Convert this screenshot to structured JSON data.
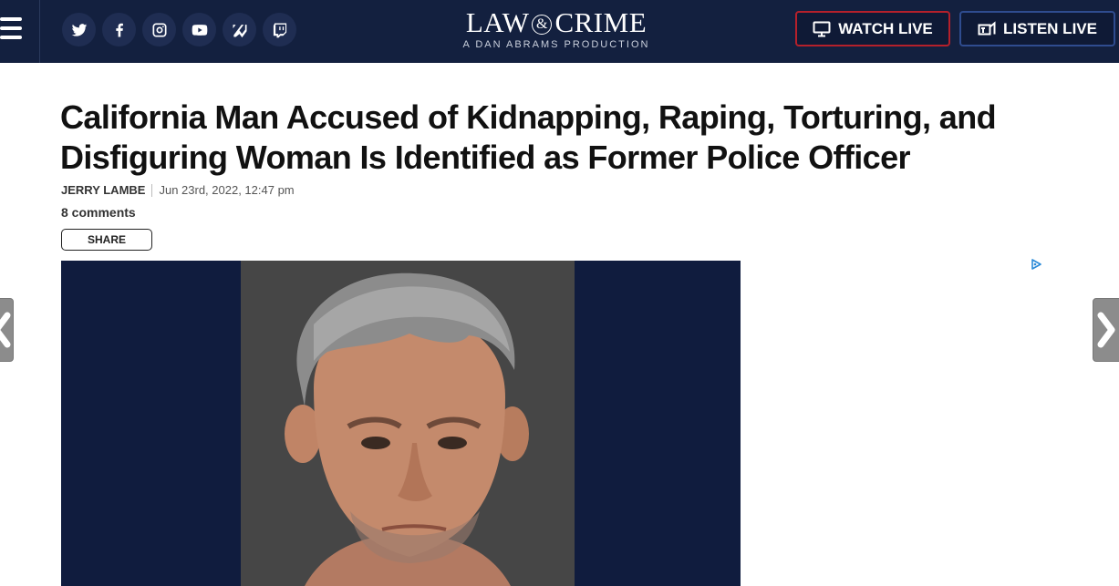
{
  "header": {
    "menu_icon": "hamburger-menu-icon",
    "social": [
      {
        "name": "twitter",
        "icon": "twitter-icon"
      },
      {
        "name": "facebook",
        "icon": "facebook-icon"
      },
      {
        "name": "instagram",
        "icon": "instagram-icon"
      },
      {
        "name": "youtube",
        "icon": "youtube-icon"
      },
      {
        "name": "apple-news",
        "icon": "apple-news-icon"
      },
      {
        "name": "twitch",
        "icon": "twitch-icon"
      }
    ],
    "logo_left": "LAW",
    "logo_amp": "&",
    "logo_right": "CRIME",
    "logo_tagline": "A DAN ABRAMS PRODUCTION",
    "watch_live": "WATCH LIVE",
    "listen_live": "LISTEN LIVE",
    "colors": {
      "bar": "#13203f",
      "watch_border": "#b5202b",
      "listen_border": "#2f4c8f"
    }
  },
  "article": {
    "headline": "California Man Accused of Kidnapping, Raping, Torturing, and Disfiguring Woman Is Identified as Former Police Officer",
    "author": "JERRY LAMBE",
    "date": "Jun 23rd, 2022, 12:47 pm",
    "comments": "8 comments",
    "share_label": "SHARE",
    "image_alt": "mugshot-photo"
  },
  "ad": {
    "icon": "adchoices-icon"
  },
  "nav": {
    "prev_icon": "chevron-left-icon",
    "next_icon": "chevron-right-icon"
  }
}
